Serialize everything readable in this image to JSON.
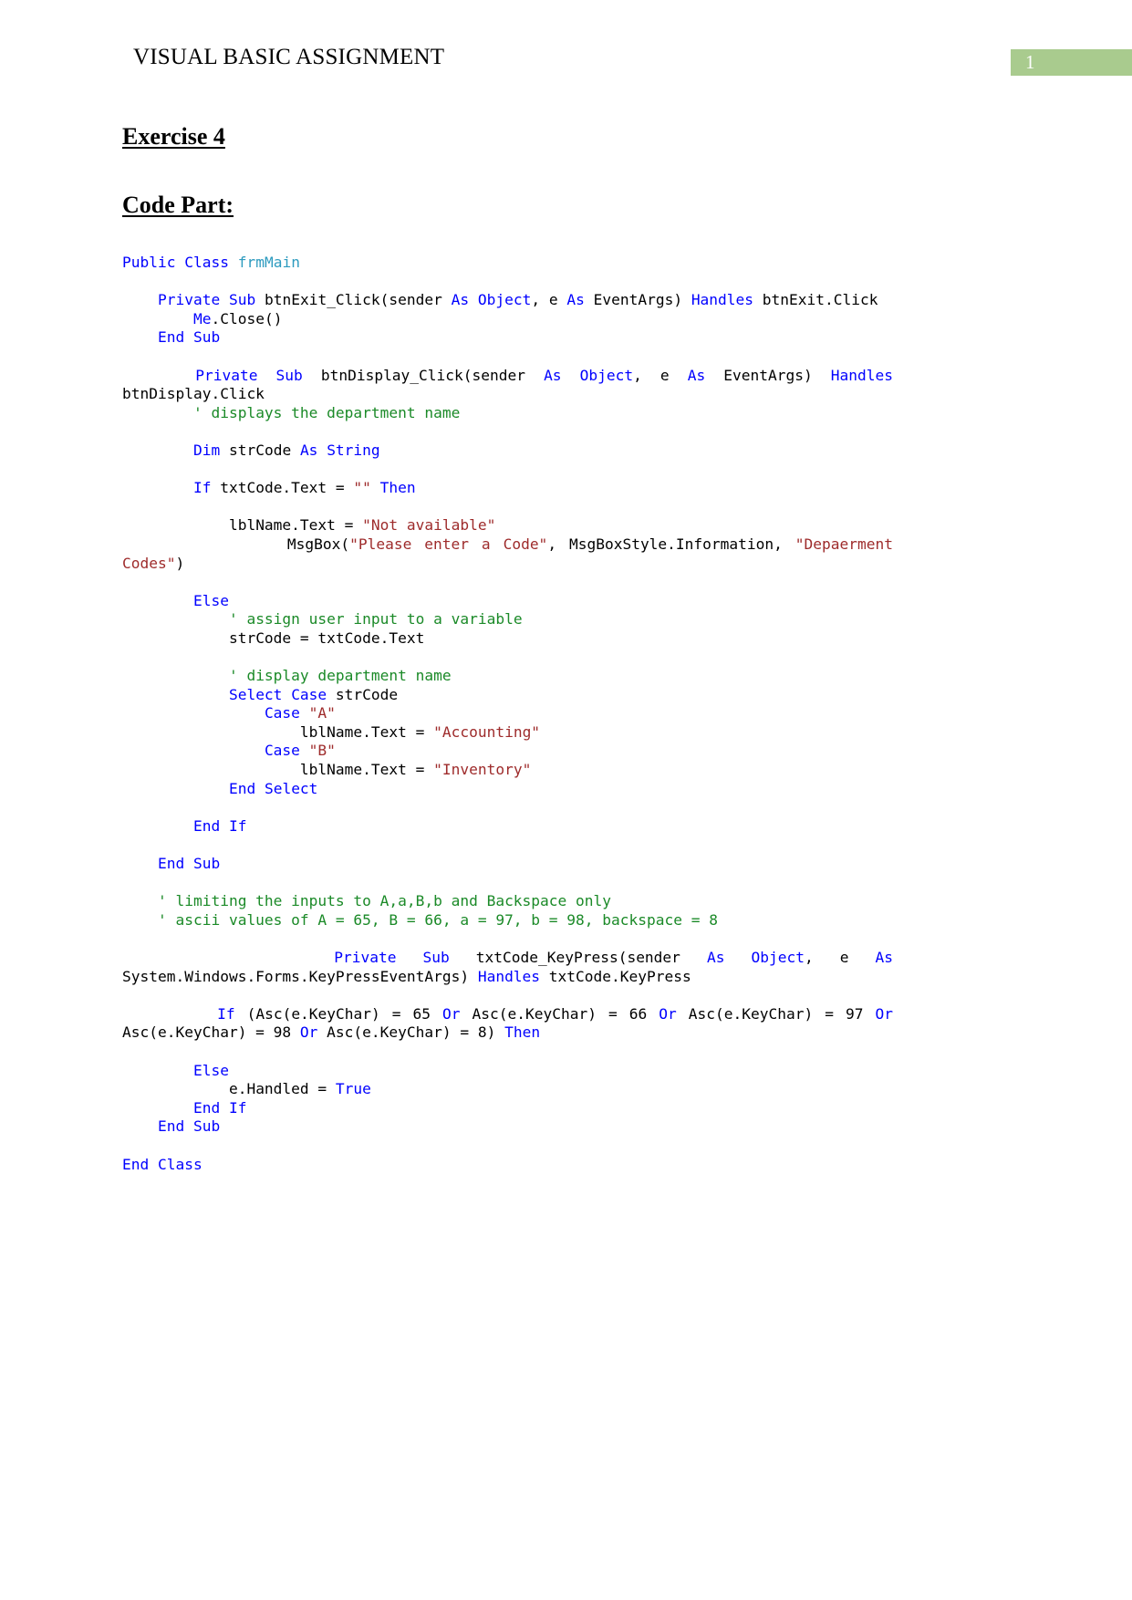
{
  "document": {
    "header": {
      "title": "VISUAL BASIC ASSIGNMENT",
      "page_number": "1",
      "badge_color": "#A9CB8E"
    },
    "headings": {
      "exercise": "Exercise 4",
      "code_part": "Code Part:"
    },
    "colors": {
      "keyword": "#0000FF",
      "type": "#2E9BBF",
      "comment": "#1B8A28",
      "string": "#9E2B2B",
      "plain": "#000000"
    },
    "code_lines": [
      {
        "id": 1,
        "justify": false,
        "tokens": [
          {
            "t": "Public",
            "c": "kw"
          },
          {
            "t": " ",
            "c": "pl"
          },
          {
            "t": "Class",
            "c": "kw"
          },
          {
            "t": " ",
            "c": "pl"
          },
          {
            "t": "frmMain",
            "c": "typ"
          }
        ]
      },
      {
        "id": 2,
        "justify": false,
        "tokens": []
      },
      {
        "id": 3,
        "justify": true,
        "tokens": [
          {
            "t": "    ",
            "c": "pl"
          },
          {
            "t": "Private",
            "c": "kw"
          },
          {
            "t": " ",
            "c": "pl"
          },
          {
            "t": "Sub",
            "c": "kw"
          },
          {
            "t": " ",
            "c": "pl"
          },
          {
            "t": "btnExit_Click(sender ",
            "c": "pl"
          },
          {
            "t": "As",
            "c": "kw"
          },
          {
            "t": " ",
            "c": "pl"
          },
          {
            "t": "Object",
            "c": "kw"
          },
          {
            "t": ", e ",
            "c": "pl"
          },
          {
            "t": "As",
            "c": "kw"
          },
          {
            "t": " ",
            "c": "pl"
          },
          {
            "t": "EventArgs) ",
            "c": "pl"
          },
          {
            "t": "Handles",
            "c": "kw"
          },
          {
            "t": " btnExit.Click",
            "c": "pl"
          }
        ]
      },
      {
        "id": 4,
        "justify": false,
        "tokens": [
          {
            "t": "        ",
            "c": "pl"
          },
          {
            "t": "Me",
            "c": "kw"
          },
          {
            "t": ".Close()",
            "c": "pl"
          }
        ]
      },
      {
        "id": 5,
        "justify": false,
        "tokens": [
          {
            "t": "    ",
            "c": "pl"
          },
          {
            "t": "End",
            "c": "kw"
          },
          {
            "t": " ",
            "c": "pl"
          },
          {
            "t": "Sub",
            "c": "kw"
          }
        ]
      },
      {
        "id": 6,
        "justify": false,
        "tokens": []
      },
      {
        "id": 7,
        "justify": true,
        "tokens": [
          {
            "t": "    ",
            "c": "pl"
          },
          {
            "t": "Private",
            "c": "kw"
          },
          {
            "t": " ",
            "c": "pl"
          },
          {
            "t": "Sub",
            "c": "kw"
          },
          {
            "t": " ",
            "c": "pl"
          },
          {
            "t": "btnDisplay_Click(sender ",
            "c": "pl"
          },
          {
            "t": "As",
            "c": "kw"
          },
          {
            "t": " ",
            "c": "pl"
          },
          {
            "t": "Object",
            "c": "kw"
          },
          {
            "t": ", e ",
            "c": "pl"
          },
          {
            "t": "As",
            "c": "kw"
          },
          {
            "t": " ",
            "c": "pl"
          },
          {
            "t": "EventArgs) ",
            "c": "pl"
          },
          {
            "t": "Handles",
            "c": "kw"
          },
          {
            "t": " btnDisplay.Click",
            "c": "pl"
          }
        ]
      },
      {
        "id": 8,
        "justify": false,
        "tokens": [
          {
            "t": "        ",
            "c": "pl"
          },
          {
            "t": "' displays the department name",
            "c": "cmt"
          }
        ]
      },
      {
        "id": 9,
        "justify": false,
        "tokens": []
      },
      {
        "id": 10,
        "justify": false,
        "tokens": [
          {
            "t": "        ",
            "c": "pl"
          },
          {
            "t": "Dim",
            "c": "kw"
          },
          {
            "t": " strCode ",
            "c": "pl"
          },
          {
            "t": "As",
            "c": "kw"
          },
          {
            "t": " ",
            "c": "pl"
          },
          {
            "t": "String",
            "c": "kw"
          }
        ]
      },
      {
        "id": 11,
        "justify": false,
        "tokens": []
      },
      {
        "id": 12,
        "justify": false,
        "tokens": [
          {
            "t": "        ",
            "c": "pl"
          },
          {
            "t": "If",
            "c": "kw"
          },
          {
            "t": " txtCode.Text = ",
            "c": "pl"
          },
          {
            "t": "\"\"",
            "c": "str"
          },
          {
            "t": " ",
            "c": "pl"
          },
          {
            "t": "Then",
            "c": "kw"
          }
        ]
      },
      {
        "id": 13,
        "justify": false,
        "tokens": []
      },
      {
        "id": 14,
        "justify": false,
        "tokens": [
          {
            "t": "            lblName.Text = ",
            "c": "pl"
          },
          {
            "t": "\"Not available\"",
            "c": "str"
          }
        ]
      },
      {
        "id": 15,
        "justify": true,
        "tokens": [
          {
            "t": "             MsgBox(",
            "c": "pl"
          },
          {
            "t": "\"Please enter a Code\"",
            "c": "str"
          },
          {
            "t": ", MsgBoxStyle.Information, ",
            "c": "pl"
          },
          {
            "t": "\"Depaerment Codes\"",
            "c": "str"
          },
          {
            "t": ")",
            "c": "pl"
          }
        ]
      },
      {
        "id": 16,
        "justify": false,
        "tokens": []
      },
      {
        "id": 17,
        "justify": false,
        "tokens": [
          {
            "t": "        ",
            "c": "pl"
          },
          {
            "t": "Else",
            "c": "kw"
          }
        ]
      },
      {
        "id": 18,
        "justify": false,
        "tokens": [
          {
            "t": "            ",
            "c": "pl"
          },
          {
            "t": "' assign user input to a variable",
            "c": "cmt"
          }
        ]
      },
      {
        "id": 19,
        "justify": false,
        "tokens": [
          {
            "t": "            strCode = txtCode.Text",
            "c": "pl"
          }
        ]
      },
      {
        "id": 20,
        "justify": false,
        "tokens": []
      },
      {
        "id": 21,
        "justify": false,
        "tokens": [
          {
            "t": "            ",
            "c": "pl"
          },
          {
            "t": "' display department name",
            "c": "cmt"
          }
        ]
      },
      {
        "id": 22,
        "justify": false,
        "tokens": [
          {
            "t": "            ",
            "c": "pl"
          },
          {
            "t": "Select",
            "c": "kw"
          },
          {
            "t": " ",
            "c": "pl"
          },
          {
            "t": "Case",
            "c": "kw"
          },
          {
            "t": " strCode",
            "c": "pl"
          }
        ]
      },
      {
        "id": 23,
        "justify": false,
        "tokens": [
          {
            "t": "                ",
            "c": "pl"
          },
          {
            "t": "Case",
            "c": "kw"
          },
          {
            "t": " ",
            "c": "pl"
          },
          {
            "t": "\"A\"",
            "c": "str"
          }
        ]
      },
      {
        "id": 24,
        "justify": false,
        "tokens": [
          {
            "t": "                    lblName.Text = ",
            "c": "pl"
          },
          {
            "t": "\"Accounting\"",
            "c": "str"
          }
        ]
      },
      {
        "id": 25,
        "justify": false,
        "tokens": [
          {
            "t": "                ",
            "c": "pl"
          },
          {
            "t": "Case",
            "c": "kw"
          },
          {
            "t": " ",
            "c": "pl"
          },
          {
            "t": "\"B\"",
            "c": "str"
          }
        ]
      },
      {
        "id": 26,
        "justify": false,
        "tokens": [
          {
            "t": "                    lblName.Text = ",
            "c": "pl"
          },
          {
            "t": "\"Inventory\"",
            "c": "str"
          }
        ]
      },
      {
        "id": 27,
        "justify": false,
        "tokens": [
          {
            "t": "            ",
            "c": "pl"
          },
          {
            "t": "End",
            "c": "kw"
          },
          {
            "t": " ",
            "c": "pl"
          },
          {
            "t": "Select",
            "c": "kw"
          }
        ]
      },
      {
        "id": 28,
        "justify": false,
        "tokens": []
      },
      {
        "id": 29,
        "justify": false,
        "tokens": [
          {
            "t": "        ",
            "c": "pl"
          },
          {
            "t": "End",
            "c": "kw"
          },
          {
            "t": " ",
            "c": "pl"
          },
          {
            "t": "If",
            "c": "kw"
          }
        ]
      },
      {
        "id": 30,
        "justify": false,
        "tokens": []
      },
      {
        "id": 31,
        "justify": false,
        "tokens": [
          {
            "t": "    ",
            "c": "pl"
          },
          {
            "t": "End",
            "c": "kw"
          },
          {
            "t": " ",
            "c": "pl"
          },
          {
            "t": "Sub",
            "c": "kw"
          }
        ]
      },
      {
        "id": 32,
        "justify": false,
        "tokens": []
      },
      {
        "id": 33,
        "justify": false,
        "tokens": [
          {
            "t": "    ",
            "c": "pl"
          },
          {
            "t": "' limiting the inputs to A,a,B,b and Backspace only",
            "c": "cmt"
          }
        ]
      },
      {
        "id": 34,
        "justify": false,
        "tokens": [
          {
            "t": "    ",
            "c": "pl"
          },
          {
            "t": "' ascii values of A = 65, B = 66, a = 97, b = 98, backspace = 8",
            "c": "cmt"
          }
        ]
      },
      {
        "id": 35,
        "justify": false,
        "tokens": []
      },
      {
        "id": 36,
        "justify": true,
        "tokens": [
          {
            "t": "        ",
            "c": "pl"
          },
          {
            "t": "Private",
            "c": "kw"
          },
          {
            "t": " ",
            "c": "pl"
          },
          {
            "t": "Sub",
            "c": "kw"
          },
          {
            "t": " ",
            "c": "pl"
          },
          {
            "t": "txtCode_KeyPress(sender ",
            "c": "pl"
          },
          {
            "t": "As",
            "c": "kw"
          },
          {
            "t": " ",
            "c": "pl"
          },
          {
            "t": "Object",
            "c": "kw"
          },
          {
            "t": ", e ",
            "c": "pl"
          },
          {
            "t": "As",
            "c": "kw"
          },
          {
            "t": " System.Windows.Forms.KeyPressEventArgs) ",
            "c": "pl"
          },
          {
            "t": "Handles",
            "c": "kw"
          },
          {
            "t": " txtCode.KeyPress",
            "c": "pl"
          }
        ]
      },
      {
        "id": 37,
        "justify": false,
        "tokens": []
      },
      {
        "id": 38,
        "justify": true,
        "tokens": [
          {
            "t": "        ",
            "c": "pl"
          },
          {
            "t": "If",
            "c": "kw"
          },
          {
            "t": " (Asc(e.KeyChar) = 65 ",
            "c": "pl"
          },
          {
            "t": "Or",
            "c": "kw"
          },
          {
            "t": " Asc(e.KeyChar) = 66 ",
            "c": "pl"
          },
          {
            "t": "Or",
            "c": "kw"
          },
          {
            "t": " Asc(e.KeyChar) = 97 ",
            "c": "pl"
          },
          {
            "t": "Or",
            "c": "kw"
          },
          {
            "t": " Asc(e.KeyChar) = 98 ",
            "c": "pl"
          },
          {
            "t": "Or",
            "c": "kw"
          },
          {
            "t": " Asc(e.KeyChar) = 8) ",
            "c": "pl"
          },
          {
            "t": "Then",
            "c": "kw"
          }
        ]
      },
      {
        "id": 39,
        "justify": false,
        "tokens": []
      },
      {
        "id": 40,
        "justify": false,
        "tokens": [
          {
            "t": "        ",
            "c": "pl"
          },
          {
            "t": "Else",
            "c": "kw"
          }
        ]
      },
      {
        "id": 41,
        "justify": false,
        "tokens": [
          {
            "t": "            e.Handled = ",
            "c": "pl"
          },
          {
            "t": "True",
            "c": "kw"
          }
        ]
      },
      {
        "id": 42,
        "justify": false,
        "tokens": [
          {
            "t": "        ",
            "c": "pl"
          },
          {
            "t": "End",
            "c": "kw"
          },
          {
            "t": " ",
            "c": "pl"
          },
          {
            "t": "If",
            "c": "kw"
          }
        ]
      },
      {
        "id": 43,
        "justify": false,
        "tokens": [
          {
            "t": "    ",
            "c": "pl"
          },
          {
            "t": "End",
            "c": "kw"
          },
          {
            "t": " ",
            "c": "pl"
          },
          {
            "t": "Sub",
            "c": "kw"
          }
        ]
      },
      {
        "id": 44,
        "justify": false,
        "tokens": []
      },
      {
        "id": 45,
        "justify": false,
        "tokens": [
          {
            "t": "End",
            "c": "kw"
          },
          {
            "t": " ",
            "c": "pl"
          },
          {
            "t": "Class",
            "c": "kw"
          }
        ]
      }
    ]
  }
}
